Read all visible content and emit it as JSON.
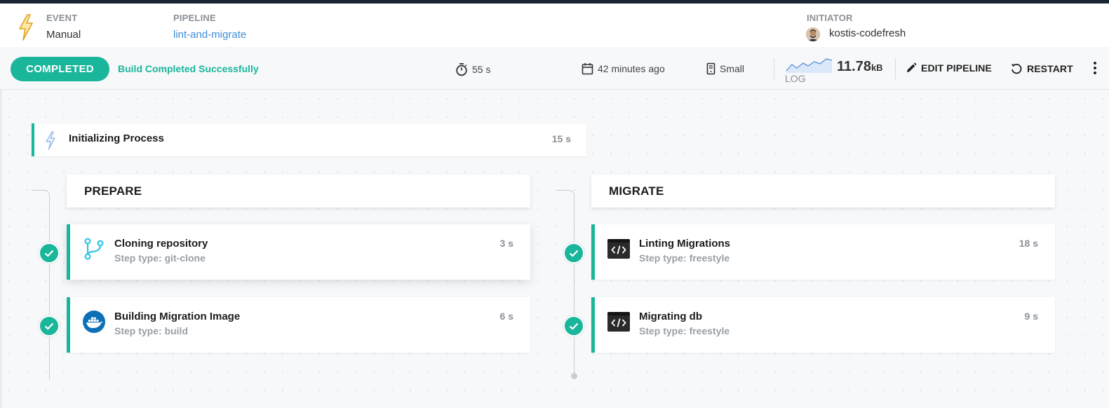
{
  "header": {
    "event_label": "EVENT",
    "event_value": "Manual",
    "pipeline_label": "PIPELINE",
    "pipeline_value": "lint-and-migrate",
    "initiator_label": "INITIATOR",
    "initiator_value": "kostis-codefresh"
  },
  "status_bar": {
    "status": "COMPLETED",
    "message": "Build Completed Successfully",
    "duration": "55 s",
    "started": "42 minutes ago",
    "size": "Small",
    "log_label": "LOG",
    "log_size_value": "11.78",
    "log_size_unit": "kB",
    "edit_label": "EDIT PIPELINE",
    "restart_label": "RESTART"
  },
  "init_step": {
    "title": "Initializing Process",
    "duration": "15 s"
  },
  "stages": [
    {
      "name": "PREPARE",
      "steps": [
        {
          "title": "Cloning repository",
          "type": "Step type: git-clone",
          "duration": "3 s",
          "icon": "git-branch-icon"
        },
        {
          "title": "Building Migration Image",
          "type": "Step type: build",
          "duration": "6 s",
          "icon": "docker-icon"
        }
      ]
    },
    {
      "name": "MIGRATE",
      "steps": [
        {
          "title": "Linting Migrations",
          "type": "Step type: freestyle",
          "duration": "18 s",
          "icon": "code-terminal-icon"
        },
        {
          "title": "Migrating db",
          "type": "Step type: freestyle",
          "duration": "9 s",
          "icon": "code-terminal-icon"
        }
      ]
    }
  ],
  "colors": {
    "accent": "#1ab69b",
    "link": "#3f8ed8",
    "docker": "#0d6fb5",
    "git": "#2ec5e3",
    "event_bolt": "#f0b429"
  }
}
